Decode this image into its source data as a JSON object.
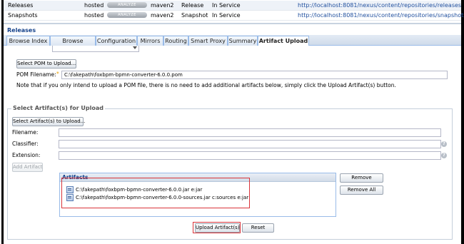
{
  "repositories": [
    {
      "name": "Releases",
      "type": "hosted",
      "analyze": "ANALYZE",
      "format": "maven2",
      "policy": "Release",
      "status": "In Service",
      "url": "http://localhost:8081/nexus/content/repositories/releases"
    },
    {
      "name": "Snapshots",
      "type": "hosted",
      "analyze": "ANALYZE",
      "format": "maven2",
      "policy": "Snapshot",
      "status": "In Service",
      "url": "http://localhost:8081/nexus/content/repositories/snapshots"
    }
  ],
  "section_title": "Releases",
  "tabs": [
    {
      "label": "Browse Index"
    },
    {
      "label": "Browse Storage"
    },
    {
      "label": "Configuration"
    },
    {
      "label": "Mirrors"
    },
    {
      "label": "Routing"
    },
    {
      "label": "Smart Proxy"
    },
    {
      "label": "Summary"
    },
    {
      "label": "Artifact Upload"
    }
  ],
  "upload": {
    "select_pom_label": "Select POM to Upload...",
    "pom_filename_label": "POM Filename:",
    "pom_filename_value": "C:\\fakepath\\foxbpm-bpmn-converter-6.0.0.pom",
    "note": "Note that if you only intend to upload a POM file, there is no need to add additional artifacts below, simply click the Upload Artifact(s) button.",
    "legend": "Select Artifact(s) for Upload",
    "select_artifacts_label": "Select Artifact(s) to Upload...",
    "filename_label": "Filename:",
    "classifier_label": "Classifier:",
    "extension_label": "Extension:",
    "add_artifact_label": "Add Artifact",
    "artifacts_title": "Artifacts",
    "artifacts": [
      "C:\\fakepath\\foxbpm-bpmn-converter-6.0.0.jar e:jar",
      "C:\\fakepath\\foxbpm-bpmn-converter-6.0.0-sources.jar c:sources e:jar"
    ],
    "remove_label": "Remove",
    "remove_all_label": "Remove All",
    "upload_label": "Upload Artifact(s)",
    "reset_label": "Reset",
    "required_mark": "*",
    "help_mark": "?"
  },
  "colors": {
    "accent": "#15428b",
    "highlight": "#d9343a",
    "link": "#1f4f9e"
  }
}
